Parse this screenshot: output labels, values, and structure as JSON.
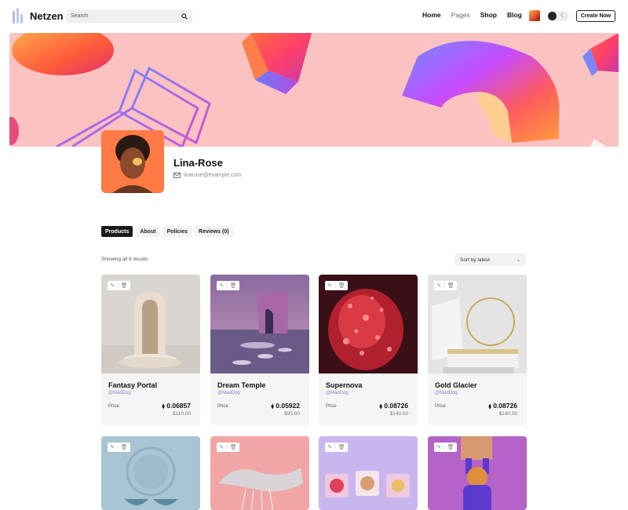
{
  "app": {
    "name": "Netzen"
  },
  "search": {
    "placeholder": "Search"
  },
  "nav": {
    "items": [
      "Home",
      "Pages",
      "Shop",
      "Blog"
    ]
  },
  "header": {
    "create_label": "Create Now"
  },
  "profile": {
    "name": "Lina-Rose",
    "email": "linarose@example.com"
  },
  "tabs": [
    "Products",
    "About",
    "Policies",
    "Reviews (0)"
  ],
  "listing": {
    "results_text": "Showing all 8 results",
    "sort_label": "Sort by latest"
  },
  "price_label": "Price",
  "products": [
    {
      "title": "Fantasy Portal",
      "creator": "@MadDog",
      "eth": "0.06857",
      "usd": "$110.00"
    },
    {
      "title": "Dream Temple",
      "creator": "@MadDog",
      "eth": "0.05922",
      "usd": "$95.00"
    },
    {
      "title": "Supernova",
      "creator": "@MadDog",
      "eth": "0.08726",
      "usd": "$140.00"
    },
    {
      "title": "Gold Glacier",
      "creator": "@MadDog",
      "eth": "0.08726",
      "usd": "$140.00"
    },
    {
      "title": "",
      "creator": "",
      "eth": "",
      "usd": ""
    },
    {
      "title": "",
      "creator": "",
      "eth": "",
      "usd": ""
    },
    {
      "title": "",
      "creator": "",
      "eth": "",
      "usd": ""
    },
    {
      "title": "",
      "creator": "",
      "eth": "",
      "usd": ""
    }
  ],
  "colors": {
    "accent": "#8a82c9",
    "banner_bg": "#fbc2c2",
    "dark": "#1a1a1a"
  }
}
